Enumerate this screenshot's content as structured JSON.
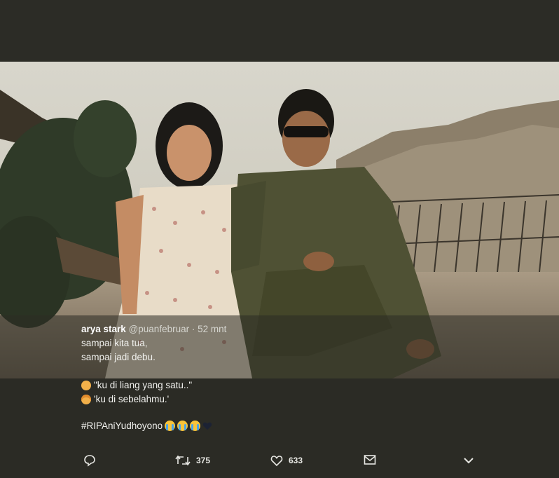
{
  "photo": {
    "description_icon": "photo-image"
  },
  "tweet": {
    "name": "arya stark",
    "handle": "@puanfebruar",
    "separator": "·",
    "time": "52 mnt",
    "line1": "sampai kita tua,",
    "line2": "sampai jadi debu.",
    "quote1": "\"ku di liang yang satu..\"",
    "quote2": "'ku di sebelahmu.'",
    "hashtag": "#RIPAniYudhoyono"
  },
  "actions": {
    "retweets": "375",
    "likes": "633"
  },
  "colors": {
    "background": "#2b2b25",
    "text": "#f1f1ee"
  }
}
